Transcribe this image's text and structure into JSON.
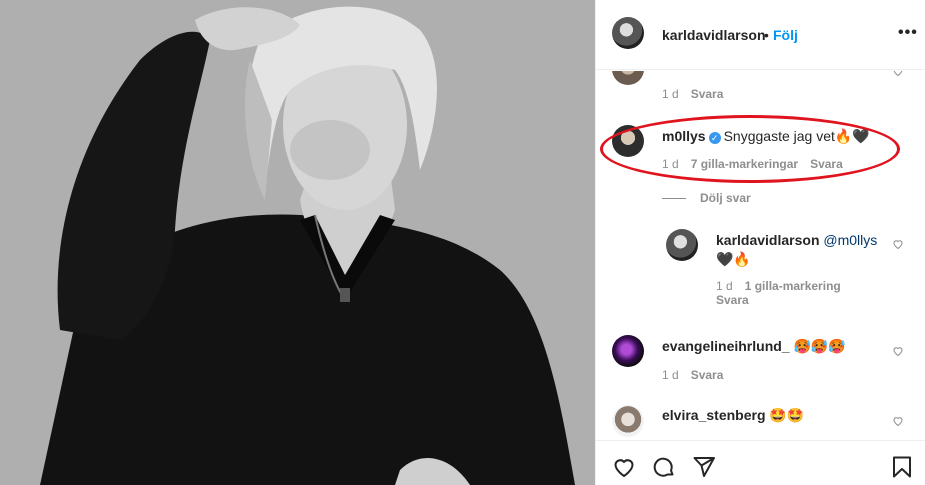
{
  "post": {
    "author": "karldavidlarson",
    "separator": "•",
    "follow_label": "Följ",
    "more_label": "•••"
  },
  "comments": [
    {
      "age": "1 d",
      "reply_label": "Svara"
    },
    {
      "username": "m0llys",
      "verified": true,
      "text": "Snyggaste jag vet🔥🖤",
      "age": "1 d",
      "likes_label": "7 gilla-markeringar",
      "reply_label": "Svara",
      "hide_replies_label": "Dölj svar",
      "replies": [
        {
          "username": "karldavidlarson",
          "mention": "@m0llys",
          "text": "🖤🔥",
          "age": "1 d",
          "likes_label": "1 gilla-markering",
          "reply_label": "Svara"
        }
      ]
    },
    {
      "username": "evangelineihrlund_",
      "text": "🥵🥵🥵",
      "age": "1 d",
      "reply_label": "Svara"
    },
    {
      "username": "elvira_stenberg",
      "text": "🤩🤩"
    }
  ],
  "actions": [
    "like-icon",
    "comment-icon",
    "share-icon",
    "save-icon"
  ],
  "colors": {
    "accent": "#0095f6",
    "highlight": "#e0141e",
    "verified": "#3897f0"
  }
}
